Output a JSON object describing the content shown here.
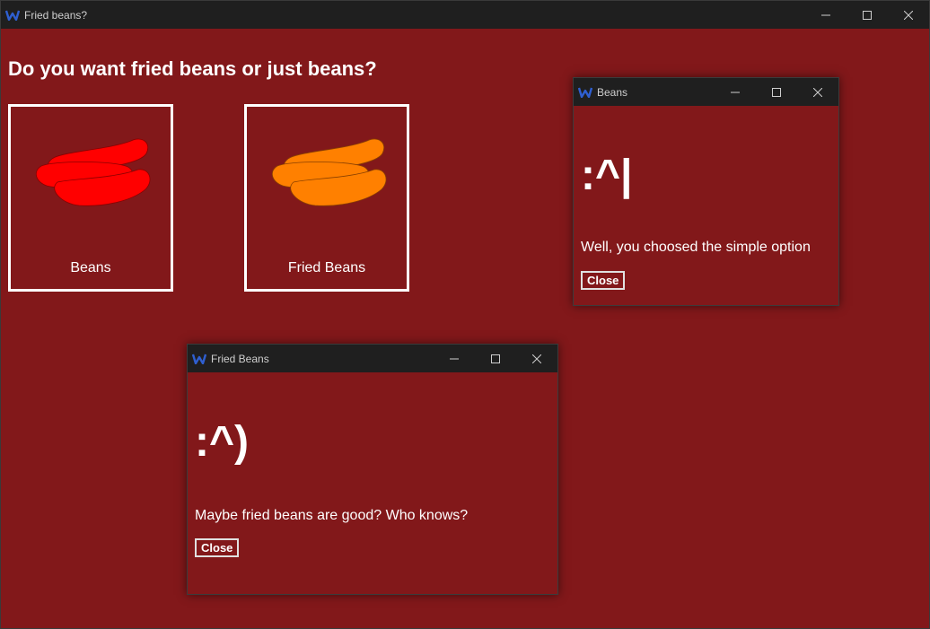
{
  "main": {
    "title": "Fried beans?",
    "question": "Do you want fried beans or just beans?",
    "choices": [
      {
        "label": "Beans",
        "color": "#ff0000"
      },
      {
        "label": "Fried Beans",
        "color": "#ff8000"
      }
    ]
  },
  "beans_dialog": {
    "title": "Beans",
    "face": ":^|",
    "message": "Well, you choosed the simple option",
    "close_label": "Close"
  },
  "fried_dialog": {
    "title": "Fried Beans",
    "face": ":^)",
    "message": "Maybe fried beans are good? Who knows?",
    "close_label": "Close"
  },
  "colors": {
    "background": "#82181a",
    "titlebar": "#1f1f1f",
    "text": "#ffffff",
    "plain_beans": "#ff0000",
    "fried_beans": "#ff8000"
  }
}
